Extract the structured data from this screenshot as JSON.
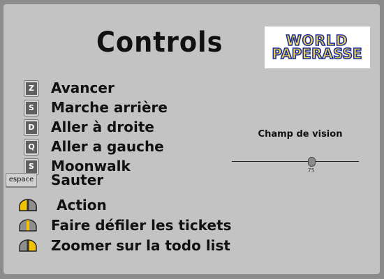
{
  "title": "Controls",
  "logo": {
    "line1": "WORLD",
    "line2": "PAPERASSE"
  },
  "keyboard_controls": [
    {
      "key": "Z",
      "action": "Avancer"
    },
    {
      "key": "S",
      "action": "Marche arrière"
    },
    {
      "key": "D",
      "action": "Aller à droite"
    },
    {
      "key": "Q",
      "action": "Aller a gauche"
    },
    {
      "key": "S",
      "action": "Moonwalk"
    },
    {
      "key": "espace",
      "action": "Sauter"
    }
  ],
  "mouse_controls": [
    {
      "button": "left",
      "action": "Action"
    },
    {
      "button": "middle",
      "action": "Faire défiler les tickets"
    },
    {
      "button": "right",
      "action": "Zoomer sur la todo list"
    }
  ],
  "fov": {
    "label": "Champ de vision",
    "value": "75",
    "min": 0,
    "max": 120
  },
  "colors": {
    "mouse_highlight": "#f2c200",
    "panel": "#c3c3c3",
    "frame": "#8c8c8c"
  }
}
